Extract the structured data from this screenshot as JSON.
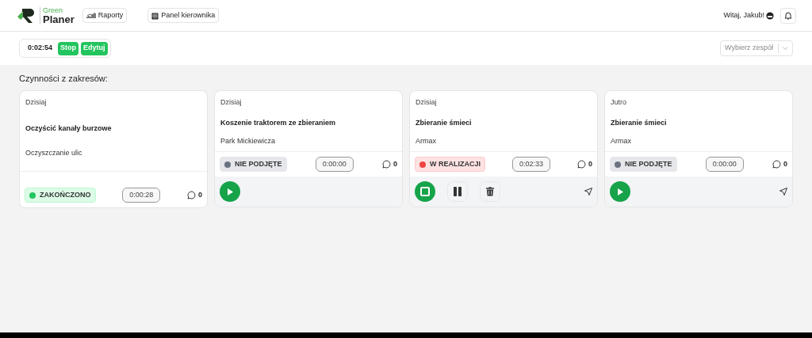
{
  "header": {
    "logo": {
      "line1": "Green",
      "line2": "Planer"
    },
    "nav": [
      "Raporty",
      "Panel kierownika"
    ],
    "greeting": "Witaj, Jakub!"
  },
  "timer": {
    "time": "0:02:54",
    "buttons": [
      "Stop",
      "Edytuj"
    ]
  },
  "team_select": {
    "placeholder": "Wybierz zespół"
  },
  "section_title": "Czynności z zakresów:",
  "cards": [
    {
      "date": "Dzisiaj",
      "title": "Oczyścić kanały burzowe",
      "subtitle": "Oczyszczanie ulic",
      "status": {
        "kind": "done",
        "label": "ZAKOŃCZONO"
      },
      "time": "0:00:28",
      "comments": "0",
      "navigate": false
    },
    {
      "date": "Dzisiaj",
      "title": "Koszenie traktorem ze zbieraniem",
      "subtitle": "Park Mickiewicza",
      "status": {
        "kind": "not_started",
        "label": "NIE PODJĘTE"
      },
      "time": "0:00:00",
      "comments": "0",
      "actions": [
        {
          "kind": "play"
        }
      ],
      "navigate": false
    },
    {
      "date": "Dzisiaj",
      "title": "Zbieranie śmieci",
      "subtitle": "Armax",
      "status": {
        "kind": "in_progress",
        "label": "W REALIZACJI"
      },
      "time": "0:02:33",
      "comments": "0",
      "actions": [
        {
          "kind": "stop"
        },
        {
          "kind": "pause"
        },
        {
          "kind": "delete"
        }
      ],
      "navigate": true
    },
    {
      "date": "Jutro",
      "title": "Zbieranie śmieci",
      "subtitle": "Armax",
      "status": {
        "kind": "not_started",
        "label": "NIE PODJĘTE"
      },
      "time": "0:00:00",
      "comments": "0",
      "actions": [
        {
          "kind": "play"
        }
      ],
      "navigate": true
    }
  ]
}
